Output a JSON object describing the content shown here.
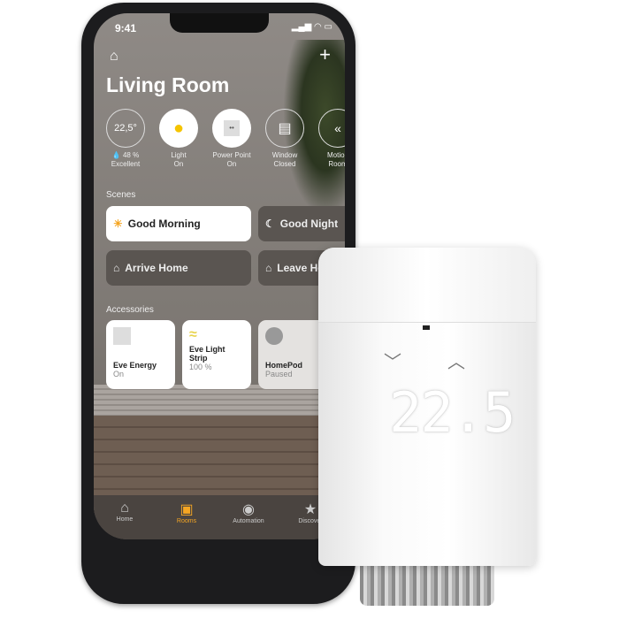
{
  "status_bar": {
    "time": "9:41"
  },
  "header": {
    "title": "Living Room",
    "home_icon": "house-icon",
    "add_icon": "plus-icon"
  },
  "tiles": [
    {
      "value": "22,5°",
      "line1": "💧 48 %",
      "line2": "Excellent"
    },
    {
      "icon": "lightbulb-icon",
      "line1": "Light",
      "line2": "On"
    },
    {
      "icon": "outlet-icon",
      "line1": "Power Point",
      "line2": "On"
    },
    {
      "icon": "window-icon",
      "line1": "Window",
      "line2": "Closed"
    },
    {
      "icon": "motion-icon",
      "line1": "Motion",
      "line2": "Room"
    }
  ],
  "scenes": {
    "label": "Scenes",
    "items": [
      "Good Morning",
      "Good Night",
      "Arrive Home",
      "Leave Home"
    ]
  },
  "accessories": {
    "label": "Accessories",
    "items": [
      {
        "name": "Eve Energy",
        "status": "On"
      },
      {
        "name": "Eve Light Strip",
        "status": "100 %"
      },
      {
        "name": "HomePod",
        "status": "Paused"
      }
    ]
  },
  "tabbar": {
    "items": [
      "Home",
      "Rooms",
      "Automation",
      "Discover"
    ],
    "active": "Rooms",
    "accent": "#f5a623"
  },
  "thermostat": {
    "display": "22.5"
  }
}
